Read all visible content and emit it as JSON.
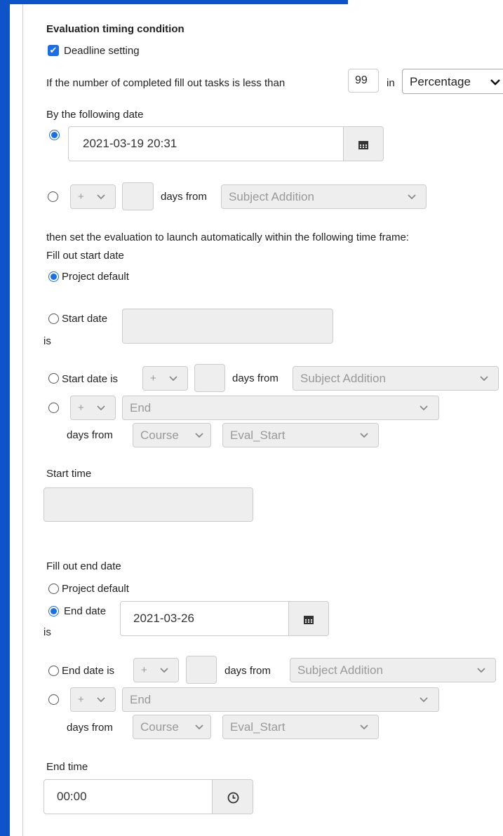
{
  "section_title": "Evaluation timing condition",
  "deadline": {
    "label": "Deadline setting",
    "checked": true
  },
  "threshold": {
    "prefix": "If the number of completed fill out tasks is less than",
    "value": "99",
    "in_label": "in",
    "unit": "Percentage"
  },
  "by_date": {
    "label": "By the following date",
    "date_value": "2021-03-19 20:31",
    "relative": {
      "sign": "+",
      "days_from_label": "days from",
      "anchor": "Subject Addition"
    }
  },
  "then_text": "then set the evaluation to launch automatically within the following time frame:",
  "start": {
    "heading": "Fill out start date",
    "project_default": "Project default",
    "start_date_is": "Start date",
    "is_word": "is",
    "start_date_is_full": "Start date is",
    "sign": "+",
    "days_from": "days from",
    "anchor": "Subject Addition",
    "end_option": "End",
    "course": "Course",
    "eval_start": "Eval_Start",
    "time_label": "Start time"
  },
  "end": {
    "heading": "Fill out end date",
    "project_default": "Project default",
    "end_date_is": "End date",
    "is_word": "is",
    "date_value": "2021-03-26",
    "end_date_is_full": "End date is",
    "sign": "+",
    "days_from": "days from",
    "anchor": "Subject Addition",
    "end_option": "End",
    "course": "Course",
    "eval_start": "Eval_Start",
    "time_label": "End time",
    "time_value": "00:00"
  },
  "icons": [
    "check-icon",
    "calendar-icon",
    "chevron-down-icon",
    "clock-icon"
  ],
  "colors": {
    "accent": "#1a6fe8",
    "frame": "#0f53c8",
    "disabled_bg": "#eeeeee"
  }
}
